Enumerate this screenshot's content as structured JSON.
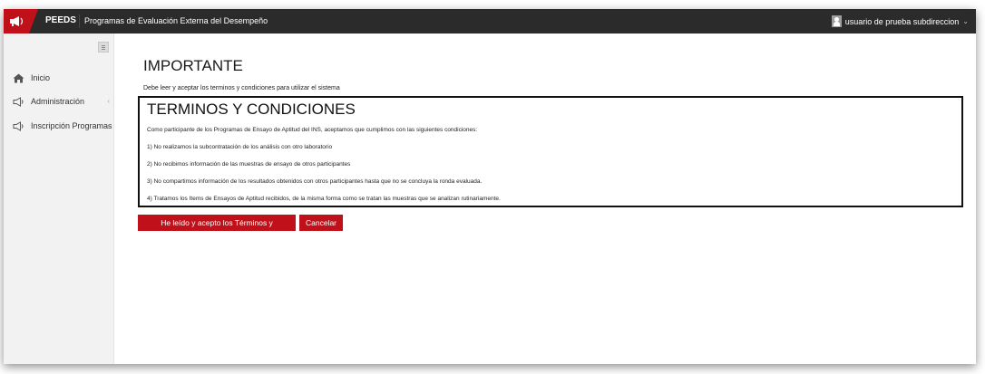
{
  "header": {
    "brand": "PEEDS",
    "title": "Programas de Evaluación Externa del Desempeño",
    "user_name": "usuario de prueba subdireccion",
    "logo_icon": "megaphone-icon"
  },
  "sidebar": {
    "items": [
      {
        "label": "Inicio",
        "icon": "home-icon"
      },
      {
        "label": "Administración",
        "icon": "megaphone-icon"
      },
      {
        "label": "Inscripción Programas",
        "icon": "megaphone-icon"
      }
    ]
  },
  "main": {
    "title": "IMPORTANTE",
    "subtitle": "Debe leer y aceptar los terminos y condiciones para utilizar el sistema",
    "terms": {
      "title": "TERMINOS Y CONDICIONES",
      "intro": "Como participante de los Programas de Ensayo de Aptitud del INS, aceptamos que cumplimos con las siguientes condiciones:",
      "items": [
        "1) No realizamos la subcontratación de los análisis con otro laboratorio",
        "2) No recibimos información de las muestras de ensayo de otros participantes",
        "3) No compartimos información de los resultados obtenidos con otros participantes hasta que no se concluya la ronda evaluada.",
        "4) Tratamos los Items de Ensayos de Aptitud recibidos, de la misma forma como se tratan las muestras que se analizan rutinariamente."
      ]
    },
    "accept_label": "He leído y acepto los Términos y Condiciones",
    "cancel_label": "Cancelar"
  },
  "colors": {
    "accent": "#c0111a",
    "topbar": "#2b2b2b",
    "sidebar": "#f2f2f2"
  }
}
